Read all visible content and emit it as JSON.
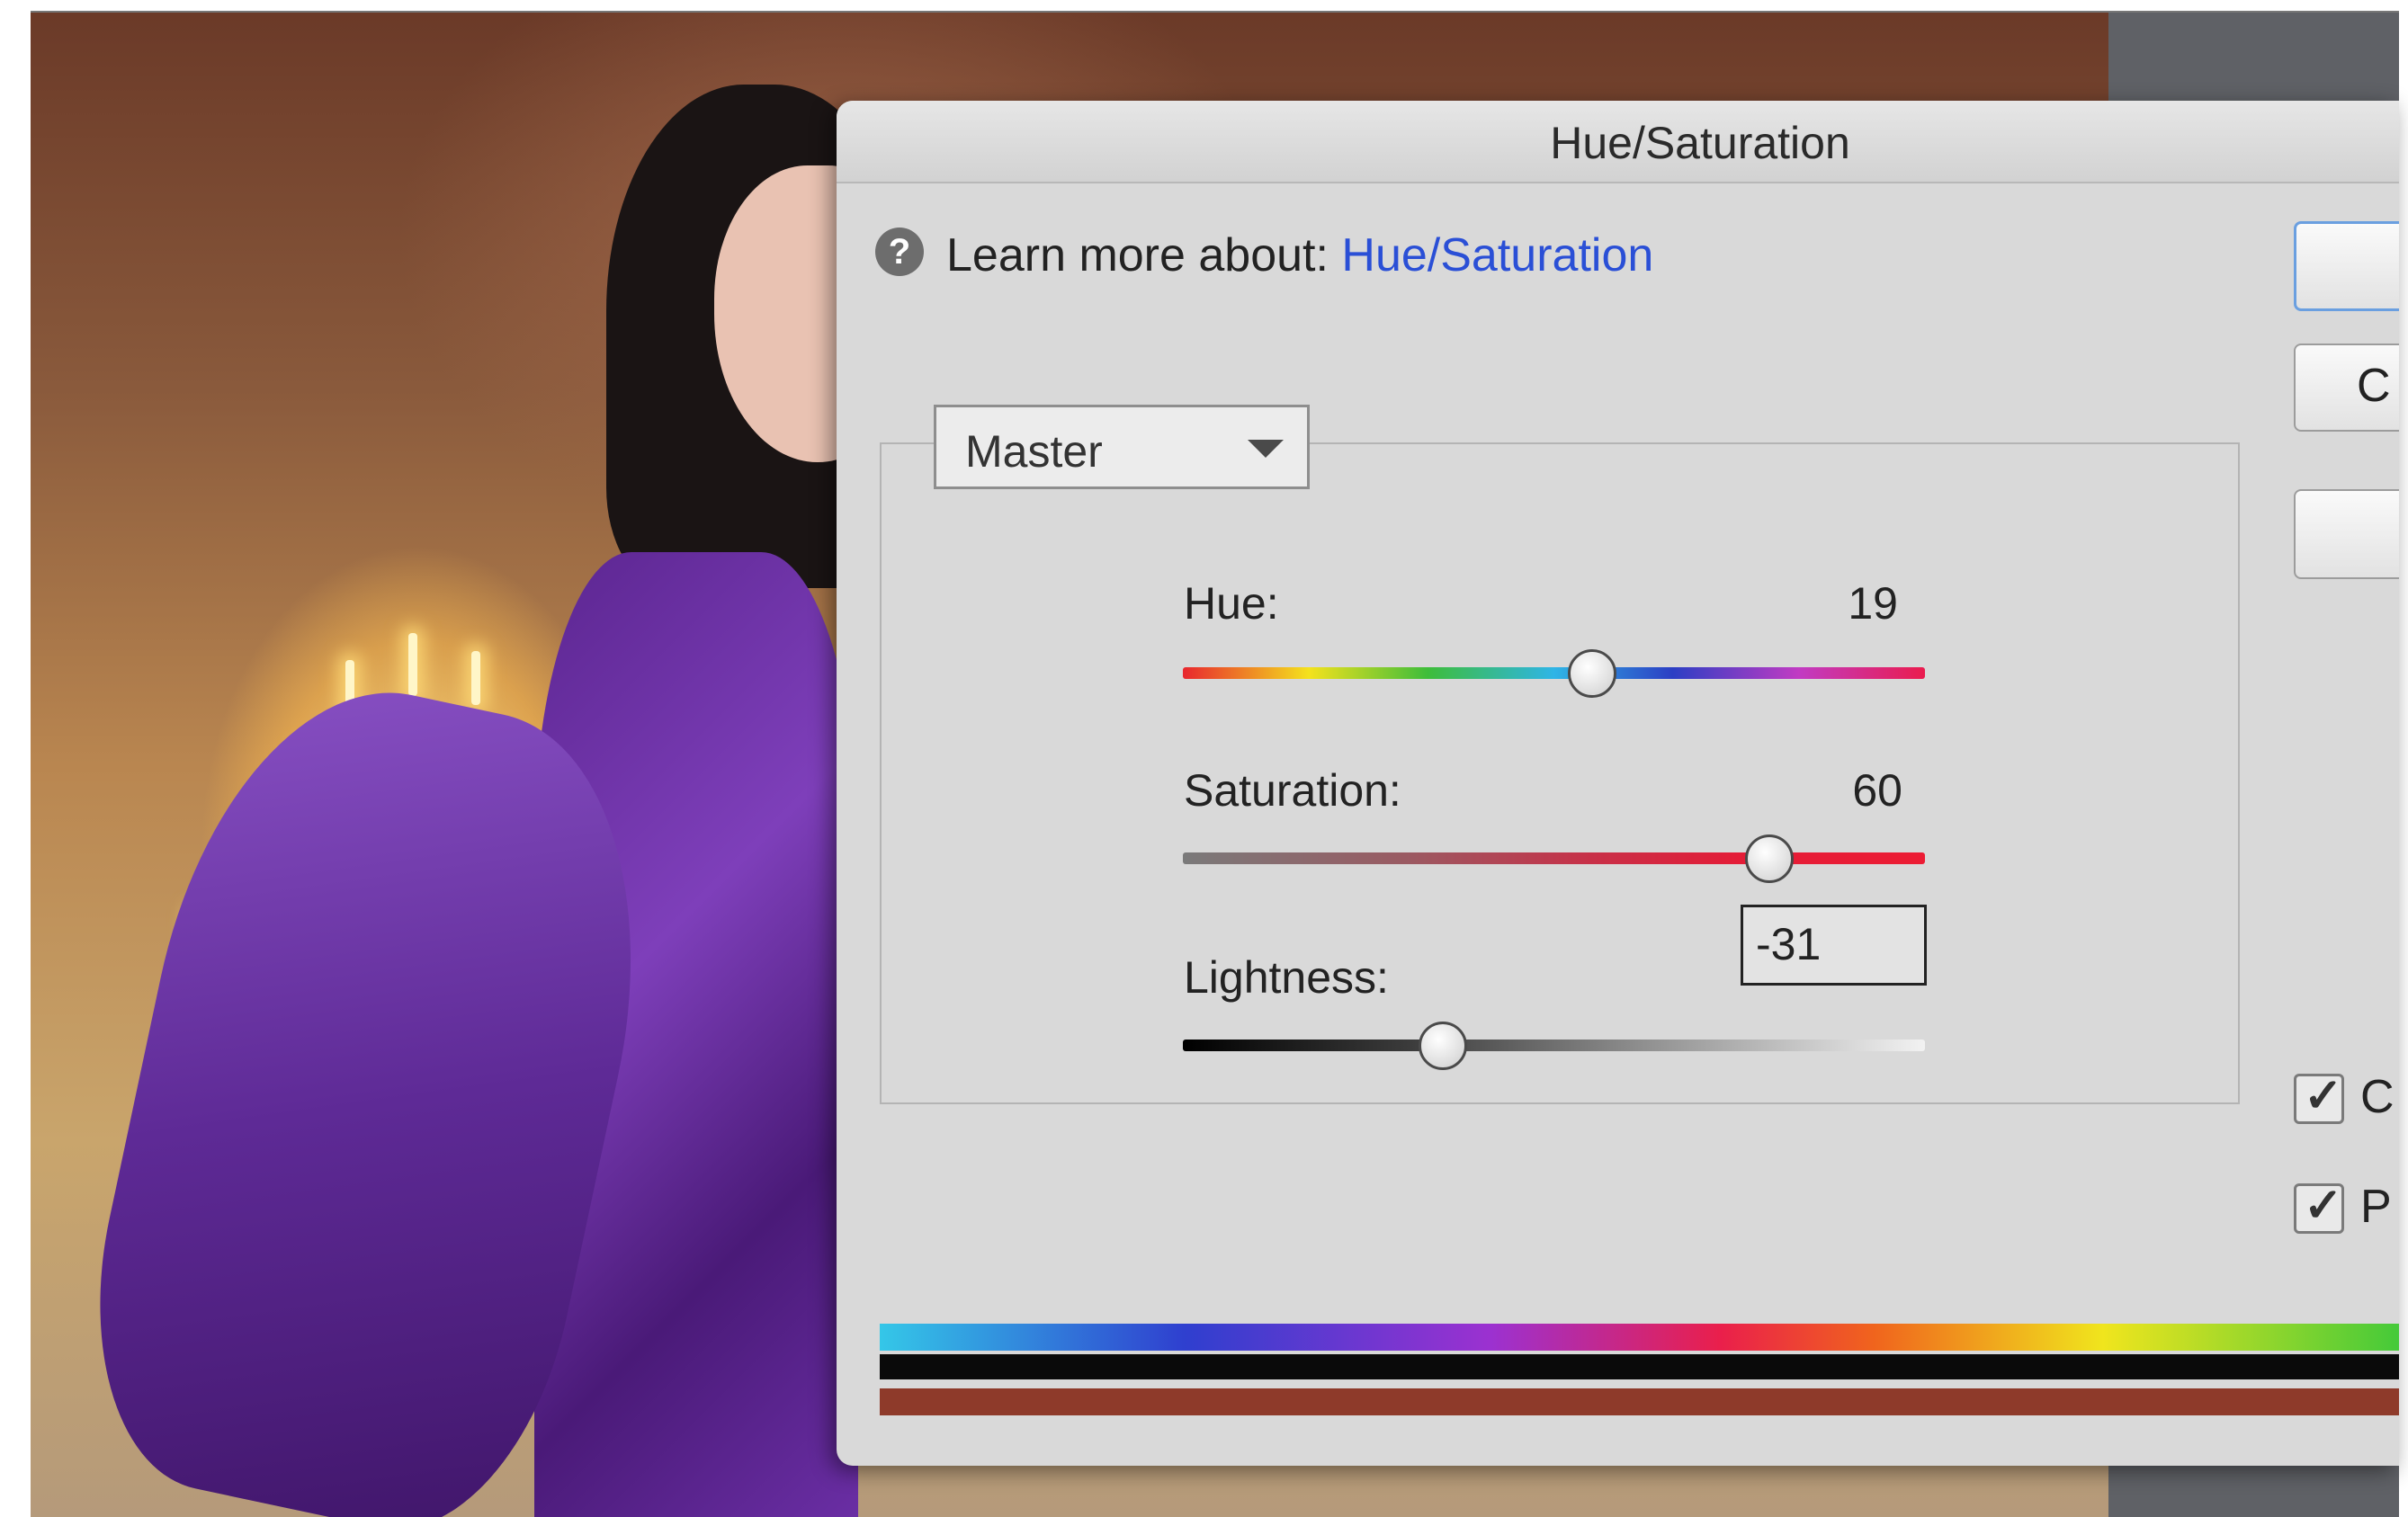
{
  "dialog": {
    "title": "Hue/Saturation",
    "help": {
      "prefix": "Learn more about: ",
      "link": "Hue/Saturation"
    },
    "preset": "Master",
    "sliders": [
      {
        "label": "Hue:",
        "value": "19",
        "min": -180,
        "max": 180,
        "numeric": 19
      },
      {
        "label": "Saturation:",
        "value": "60",
        "min": -100,
        "max": 100,
        "numeric": 60
      },
      {
        "label": "Lightness:",
        "value": "-31",
        "min": -100,
        "max": 100,
        "numeric": -31
      }
    ],
    "buttons": {
      "ok": "",
      "cancel": "C",
      "help": ""
    },
    "checkboxes": [
      {
        "label": "C",
        "checked": true
      },
      {
        "label": "P",
        "checked": true
      }
    ]
  },
  "colors": {
    "link": "#2a4fd6",
    "dialog_bg": "#d9d9d9"
  }
}
